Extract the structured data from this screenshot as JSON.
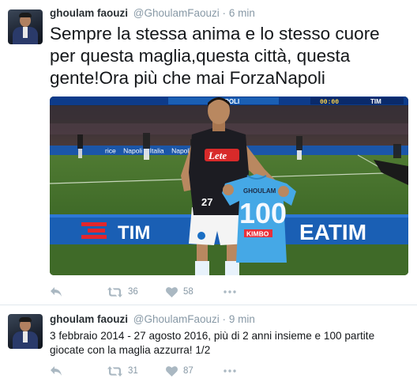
{
  "tweets": [
    {
      "author_name": "ghoulam faouzi",
      "handle": "@GhoulamFaouzi",
      "separator": "·",
      "time": "6 min",
      "text": "Sempre la stessa anima e lo stesso cuore per questa maglia,questa città, questa gente!Ora più che mai ForzaNapoli",
      "retweets": "36",
      "likes": "58",
      "photo": {
        "jersey_sponsor": "Lete",
        "shirt_number": "27",
        "held_jersey_name": "GHOULAM",
        "held_jersey_number": "100",
        "held_jersey_sponsor": "KIMBO",
        "board_brand_1": "TIM",
        "board_brand_2": "EATIM",
        "top_board_left": "NAPOLI",
        "top_board_right": "TIM",
        "scoreboard_time": "00:00",
        "mid_board_text": "rice    Napoli    Italia    Napoli d'autore"
      }
    },
    {
      "author_name": "ghoulam faouzi",
      "handle": "@GhoulamFaouzi",
      "separator": "·",
      "time": "9 min",
      "text": "3 febbraio 2014 - 27 agosto 2016, più di 2 anni insieme e 100 partite giocate  con la maglia azzurra! 1/2",
      "retweets": "31",
      "likes": "87"
    }
  ],
  "colors": {
    "name": "#292f33",
    "meta": "#8899a6",
    "icon": "#aab8c2",
    "divider": "#e1e8ed",
    "board_blue": "#1a5fb4",
    "tim_red": "#e3262c"
  }
}
